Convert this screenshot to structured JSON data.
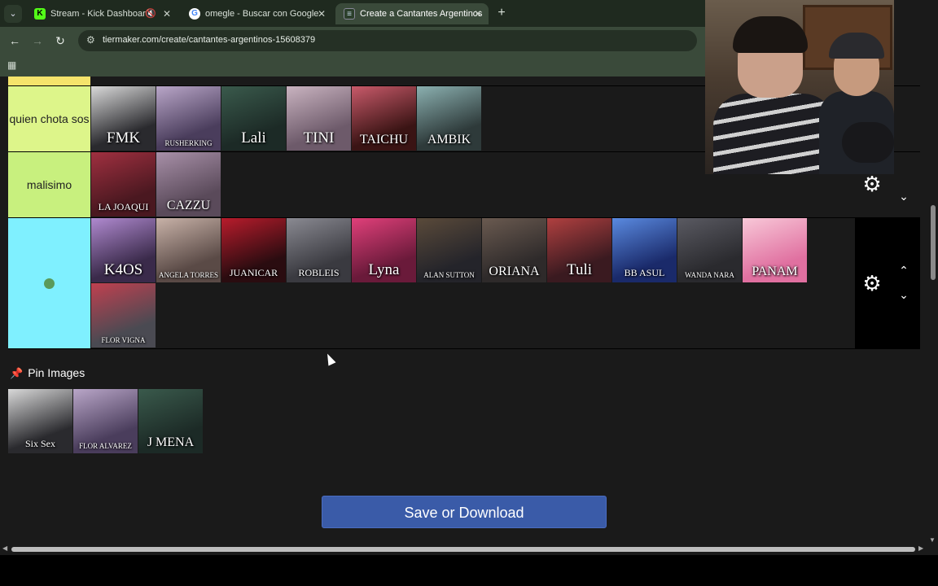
{
  "browser": {
    "tabs": [
      {
        "title": "Stream - Kick Dashboard",
        "favicon": "kick-icon",
        "muted": true,
        "active": false
      },
      {
        "title": "omegle - Buscar con Google",
        "favicon": "google-icon",
        "muted": false,
        "active": false
      },
      {
        "title": "Create a Cantantes Argentinos",
        "favicon": "tiermaker-icon",
        "muted": false,
        "active": true
      }
    ],
    "url": "tiermaker.com/create/cantantes-argentinos-15608379",
    "new_tab_label": "+"
  },
  "tiers": [
    {
      "label": "quien chota sos",
      "color": "#ddf58a",
      "items": [
        "FMK",
        "RUSHERKING",
        "Lali",
        "TINI",
        "TAICHU",
        "AMBIK"
      ]
    },
    {
      "label": "malisimo",
      "color": "#c8f07e",
      "items": [
        "LA JOAQUI",
        "CAZZU"
      ]
    },
    {
      "label": "",
      "label_icon": "nauseated-face-icon",
      "color": "#7ff0ff",
      "items": [
        "K4OS",
        "ANGELA TORRES",
        "JUANICAR",
        "ROBLEIS",
        "Lyna",
        "ALAN SUTTON",
        "ORIANA",
        "Tuli",
        "BB ASUL",
        "WANDA NARA",
        "PANAM",
        "FLOR VIGNA"
      ]
    }
  ],
  "pin_images": {
    "title": "Pin Images",
    "items": [
      "Six Sex",
      "FLOR ALVAREZ",
      "J MENA"
    ]
  },
  "save_button": "Save or Download",
  "colors": {
    "page_bg": "#1a1a1a",
    "save_button_bg": "#3a5ba8",
    "browser_frame": "#3a4a3a"
  }
}
